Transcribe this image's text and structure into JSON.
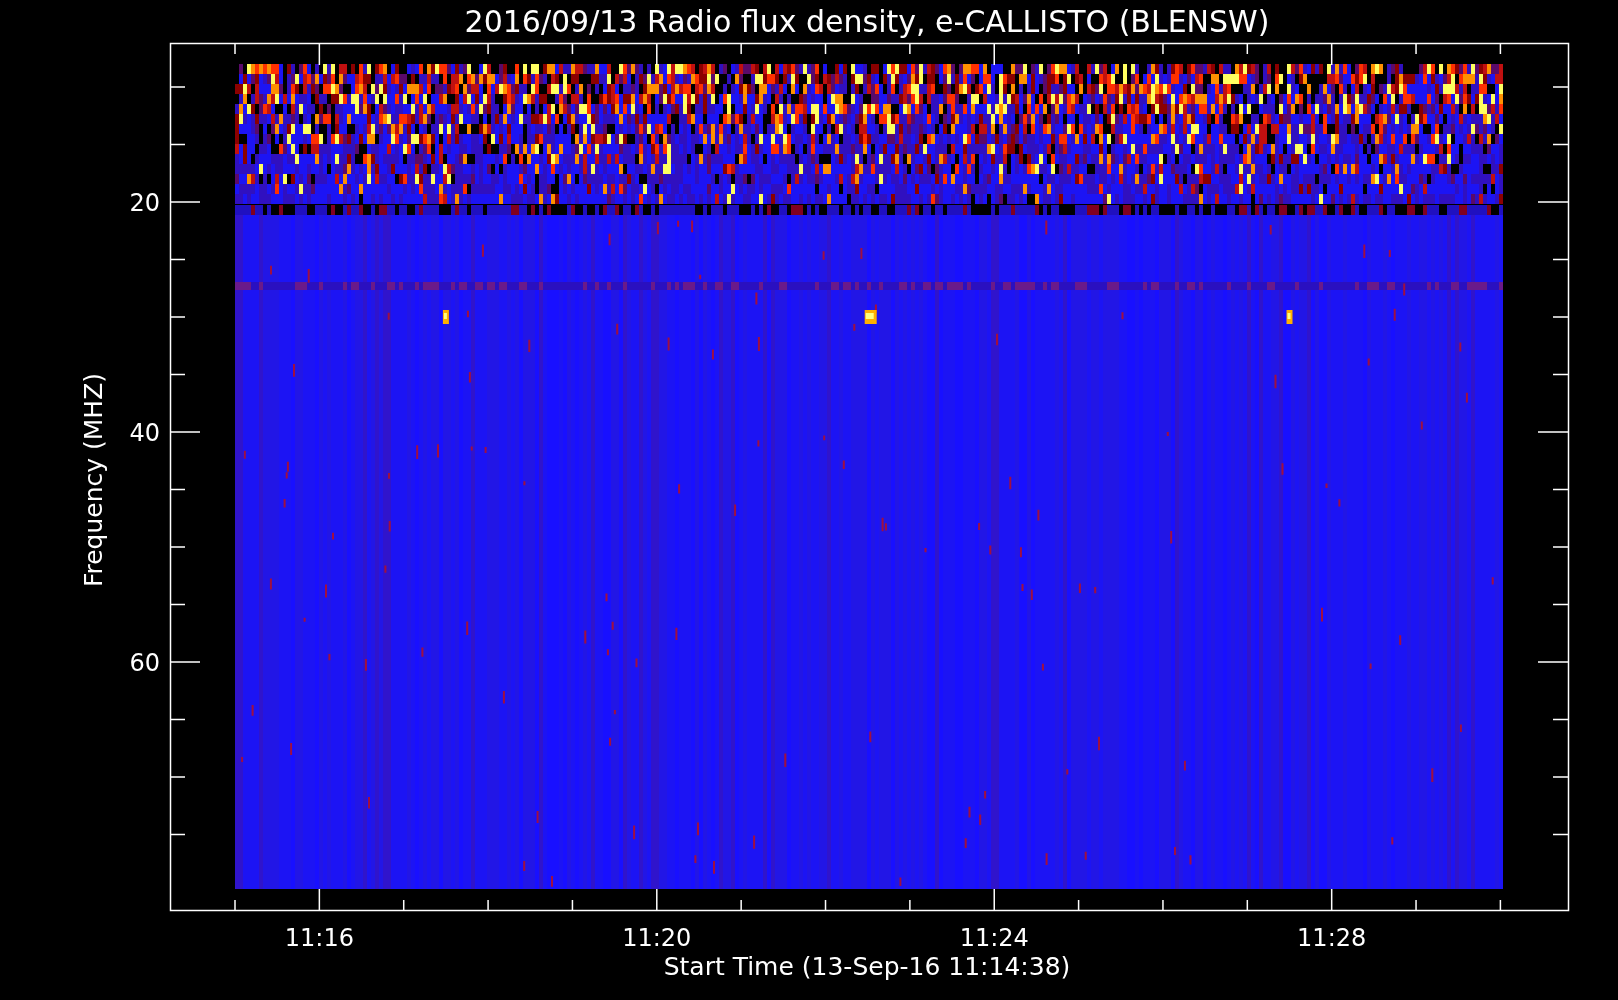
{
  "plot": {
    "title": "2016/09/13  Radio flux density, e-CALLISTO (BLENSW)",
    "xlabel": "Start Time (13-Sep-16 11:14:38)",
    "ylabel": "Frequency (MHZ)",
    "x_tick_labels": [
      "11:16",
      "11:20",
      "11:24",
      "11:28"
    ],
    "y_tick_labels": [
      "20",
      "40",
      "60"
    ]
  }
}
